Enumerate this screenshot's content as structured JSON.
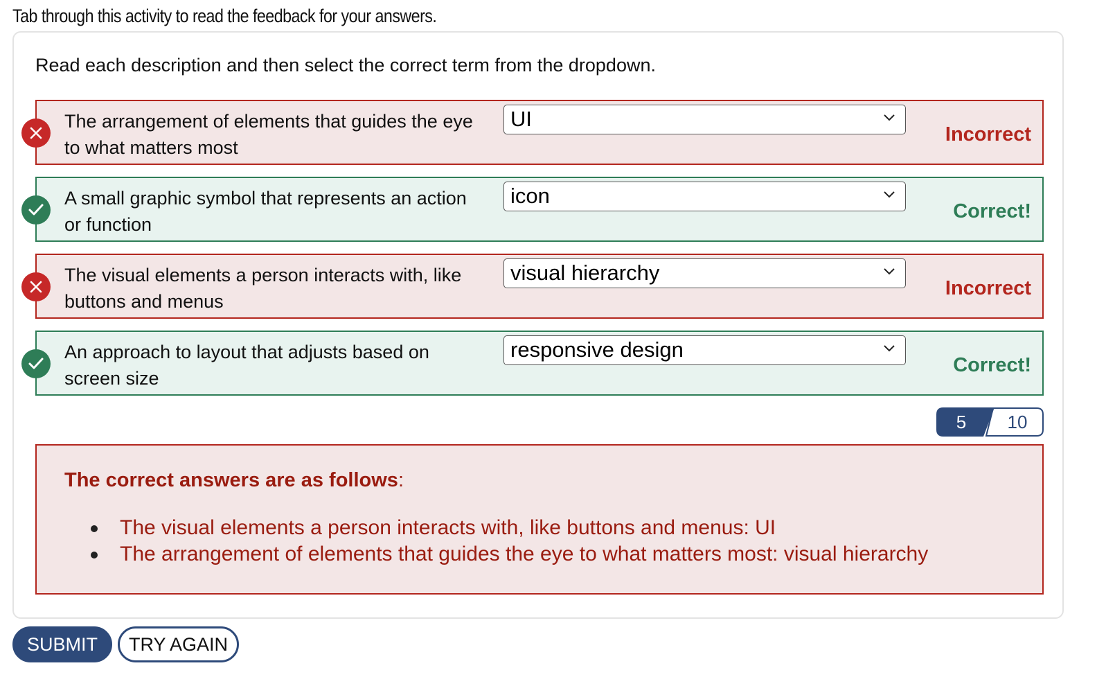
{
  "instruction": "Tab through this activity to read the feedback for your answers.",
  "prompt": "Read each description and then select the correct term from the dropdown.",
  "questions": [
    {
      "text": "The arrangement of elements that guides the eye to what matters most",
      "selected": "UI",
      "status": "incorrect",
      "feedback": "Incorrect"
    },
    {
      "text": "A small graphic symbol that represents an action or function",
      "selected": "icon",
      "status": "correct",
      "feedback": "Correct!"
    },
    {
      "text": "The visual elements a person interacts with, like buttons and menus",
      "selected": "visual hierarchy",
      "status": "incorrect",
      "feedback": "Incorrect"
    },
    {
      "text": "An approach to layout that adjusts based on screen size",
      "selected": "responsive design",
      "status": "correct",
      "feedback": "Correct!"
    }
  ],
  "score": {
    "earned": "5",
    "total": "10"
  },
  "answers": {
    "title_bold": "The correct answers are as follows",
    "title_suffix": ":",
    "items": [
      "The visual elements a person interacts with, like buttons and menus: UI",
      "The arrangement of elements that guides the eye to what matters most: visual hierarchy"
    ]
  },
  "buttons": {
    "submit": "SUBMIT",
    "try_again": "TRY AGAIN"
  },
  "colors": {
    "incorrect": "#b3261e",
    "incorrect_bg": "#f3e6e6",
    "correct": "#2e7d57",
    "correct_bg": "#e8f3ef",
    "primary": "#2e4a7a"
  },
  "icons": {
    "incorrect": "x-circle-icon",
    "correct": "check-circle-icon",
    "dropdown": "chevron-down-icon"
  }
}
